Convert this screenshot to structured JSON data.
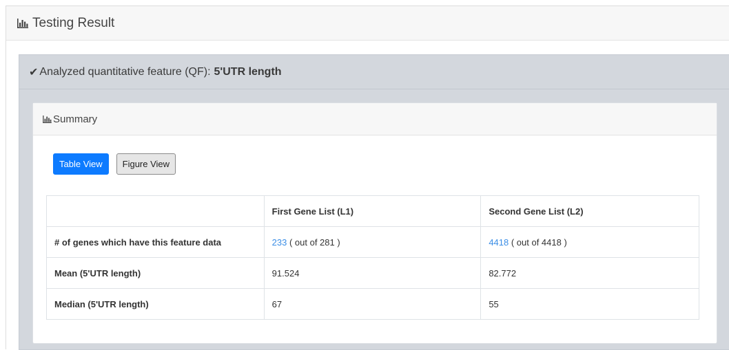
{
  "outer": {
    "title": "Testing Result",
    "icon": "bar-chart-icon"
  },
  "qf": {
    "check_icon": "✔",
    "label": "Analyzed quantitative feature (QF):",
    "value": "5'UTR length"
  },
  "summary": {
    "title": "Summary",
    "icon": "bar-chart-icon"
  },
  "buttons": {
    "table_view": "Table View",
    "figure_view": "Figure View",
    "active": "table_view",
    "active_color": "#0d7bff"
  },
  "table": {
    "headers": [
      "",
      "First Gene List (L1)",
      "Second Gene List (L2)"
    ],
    "rows": [
      {
        "label": "# of genes which have this feature data",
        "l1_link": "233",
        "l1_suffix": " ( out of 281 )",
        "l2_link": "4418",
        "l2_suffix": " ( out of 4418 )"
      },
      {
        "label": "Mean (5'UTR length)",
        "l1": "91.524",
        "l2": "82.772"
      },
      {
        "label": "Median (5'UTR length)",
        "l1": "67",
        "l2": "55"
      }
    ]
  },
  "colors": {
    "link": "#3b8ee6",
    "qf_panel_bg": "#d3d7dd"
  }
}
